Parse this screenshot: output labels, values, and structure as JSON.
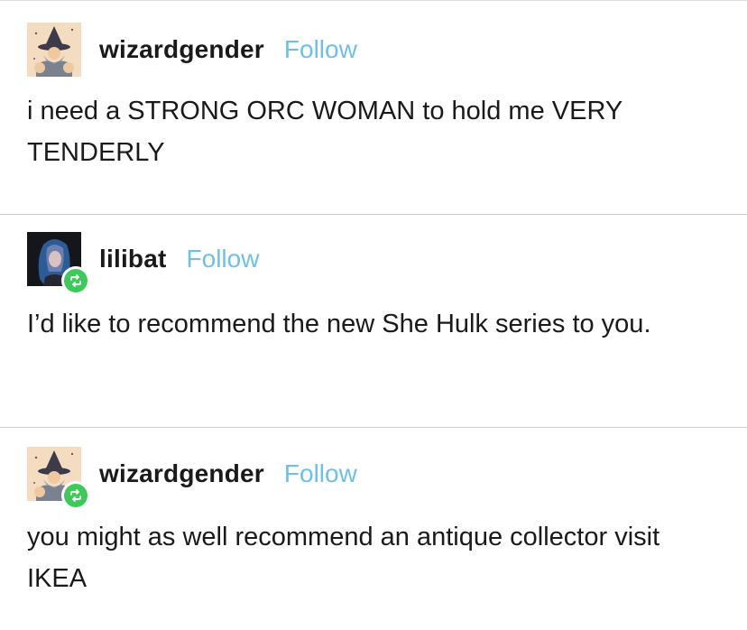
{
  "posts": [
    {
      "username": "wizardgender",
      "follow_label": "Follow",
      "avatar_icon": "wizard-avatar-icon",
      "reblogged": false,
      "body": "i need a STRONG ORC WOMAN to hold me VERY TENDERLY"
    },
    {
      "username": "lilibat",
      "follow_label": "Follow",
      "avatar_icon": "person-avatar-icon",
      "reblogged": true,
      "body": "I’d like to recommend the new She Hulk series to you."
    },
    {
      "username": "wizardgender",
      "follow_label": "Follow",
      "avatar_icon": "wizard-avatar-icon",
      "reblogged": true,
      "body": "you might as well recommend an antique collector visit IKEA"
    }
  ],
  "colors": {
    "follow": "#6fc0e6",
    "reblog_badge": "#3ec95a",
    "text": "#1a1a1a",
    "divider": "#cfcfcf"
  }
}
